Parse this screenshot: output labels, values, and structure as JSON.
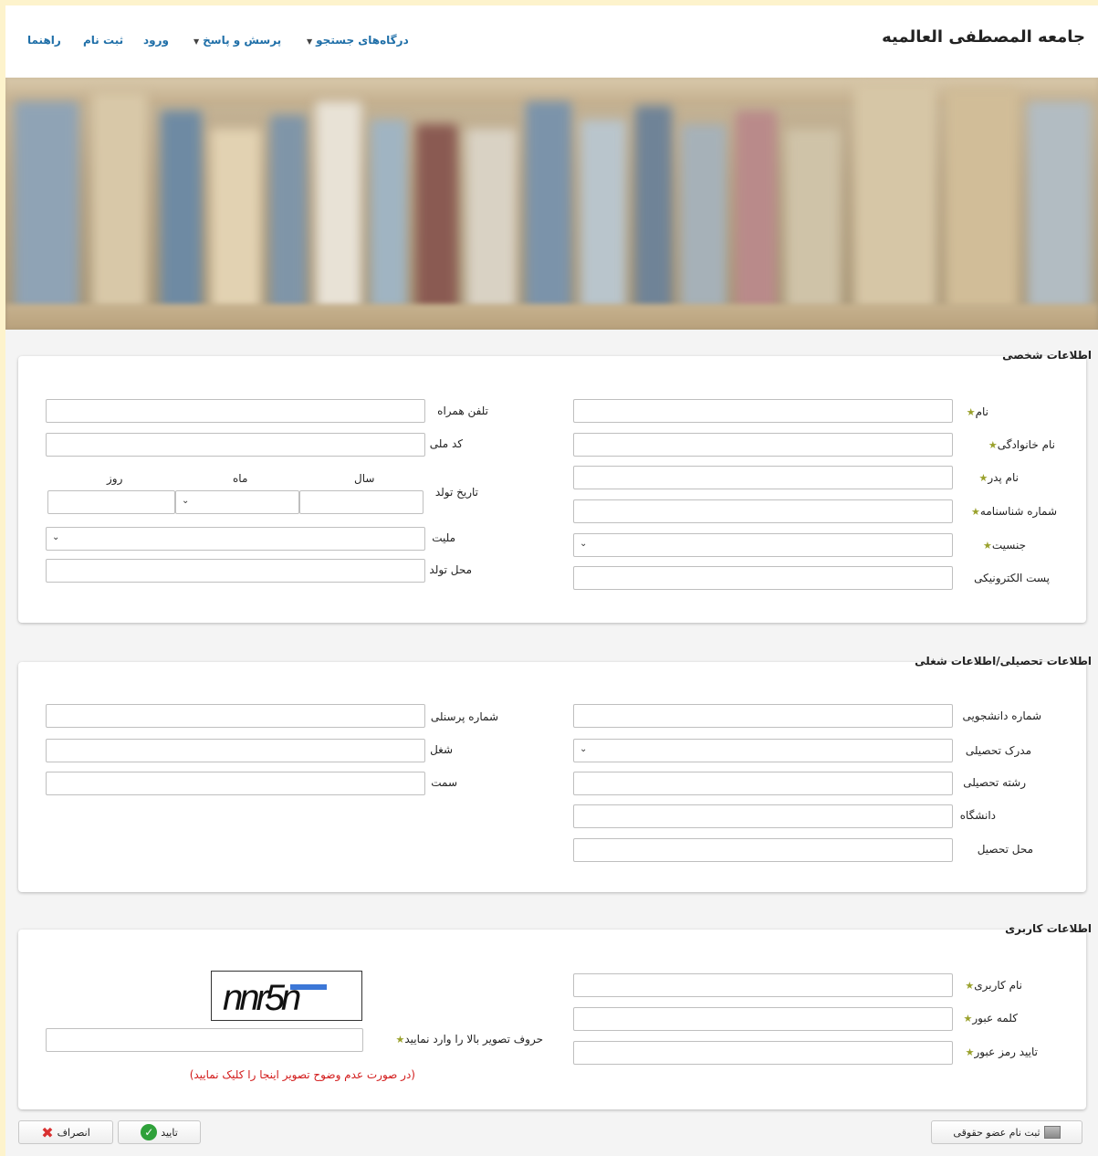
{
  "header": {
    "site_title": "جامعه المصطفی العالمیه",
    "nav": [
      {
        "label": "درگاه‌های جستجو",
        "dropdown": true
      },
      {
        "label": "پرسش و پاسخ",
        "dropdown": true
      },
      {
        "label": "ورود",
        "dropdown": false
      },
      {
        "label": "ثبت نام",
        "dropdown": false
      },
      {
        "label": "راهنما",
        "dropdown": false
      }
    ]
  },
  "personal": {
    "title": "اطلاعات شخصی",
    "first_name": "نام",
    "last_name": "نام خانوادگی",
    "father_name": "نام پدر",
    "id_number": "شماره شناسنامه",
    "gender": "جنسیت",
    "email": "پست الکترونیکی",
    "mobile": "تلفن همراه",
    "national_code": "کد ملی",
    "birth_date": "تاریخ تولد",
    "year": "سال",
    "month": "ماه",
    "day": "روز",
    "nationality": "ملیت",
    "birth_place": "محل تولد"
  },
  "education": {
    "title": "اطلاعات تحصیلی/اطلاعات شغلی",
    "student_number": "شماره دانشجویی",
    "degree": "مدرک تحصیلی",
    "field": "رشته تحصیلی",
    "university": "دانشگاه",
    "study_place": "محل تحصیل",
    "personnel_number": "شماره پرسنلی",
    "job": "شغل",
    "position": "سمت"
  },
  "user": {
    "title": "اطلاعات کاربری",
    "username": "نام کاربری",
    "password": "کلمه عبور",
    "confirm_password": "تایید رمز عبور",
    "captcha_label": "حروف تصویر بالا را وارد نمایید",
    "captcha_text": "nnr5n",
    "captcha_hint": "(در صورت عدم وضوح تصویر اینجا را کلیک نمایید)"
  },
  "buttons": {
    "legal_member": "ثبت نام عضو حقوقی",
    "confirm": "تایید",
    "cancel": "انصراف"
  },
  "colors": {
    "nav_link": "#1f6fa8",
    "required_star": "#9aa12c",
    "hint_red": "#d21a1a",
    "confirm_green": "#2fa13a",
    "cancel_red": "#d93030"
  }
}
